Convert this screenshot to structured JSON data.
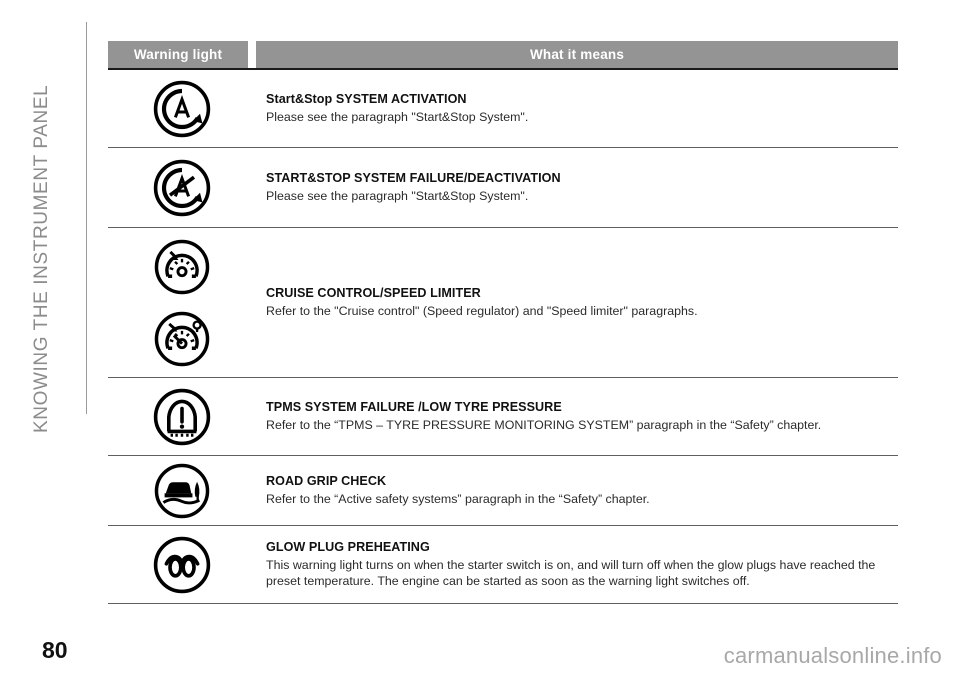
{
  "chapter": {
    "title": "KNOWING THE INSTRUMENT PANEL"
  },
  "page": {
    "number": "80",
    "watermark": "carmanualsonline.info"
  },
  "table": {
    "headers": {
      "icon_column": "Warning light",
      "text_column": "What it means"
    },
    "rows": [
      {
        "icon_names": [
          "start-stop-activation-icon"
        ],
        "title": "Start&Stop SYSTEM ACTIVATION",
        "body": "Please see the paragraph \"Start&Stop System\"."
      },
      {
        "icon_names": [
          "start-stop-failure-icon"
        ],
        "title": "START&STOP SYSTEM FAILURE/DEACTIVATION",
        "body": "Please see the paragraph \"Start&Stop System\"."
      },
      {
        "icon_names": [
          "cruise-control-icon",
          "speed-limiter-icon"
        ],
        "title": "CRUISE CONTROL/SPEED LIMITER",
        "body": "Refer to the \"Cruise control\" (Speed regulator) and \"Speed limiter\" paragraphs."
      },
      {
        "icon_names": [
          "tpms-low-tyre-pressure-icon"
        ],
        "title": "TPMS SYSTEM FAILURE /LOW TYRE PRESSURE",
        "body": "Refer to the “TPMS – TYRE PRESSURE MONITORING SYSTEM” paragraph in the “Safety” chapter."
      },
      {
        "icon_names": [
          "road-grip-check-icon"
        ],
        "title": "ROAD GRIP CHECK",
        "body": "Refer to the “Active safety systems” paragraph in the “Safety” chapter."
      },
      {
        "icon_names": [
          "glow-plug-preheating-icon"
        ],
        "title": "GLOW PLUG PREHEATING",
        "body": "This warning light turns on when the starter switch is on, and will turn off when the glow plugs have reached the preset temperature. The engine can be started as soon as the warning light switches off."
      }
    ]
  },
  "colors": {
    "header_bar": "#949494",
    "header_text": "#ffffff",
    "rule": "#5f5f5f",
    "chapter_text": "#8c8c8c",
    "watermark_text": "#a8a8a8",
    "icon_stroke": "#000000"
  }
}
